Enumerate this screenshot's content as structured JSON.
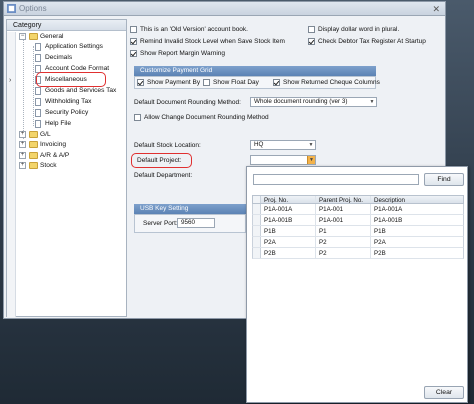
{
  "window": {
    "title": "Options"
  },
  "tree": {
    "header": "Category",
    "items": [
      {
        "label": "General"
      },
      {
        "label": "Application Settings"
      },
      {
        "label": "Decimals"
      },
      {
        "label": "Account Code Format"
      },
      {
        "label": "Miscellaneous"
      },
      {
        "label": "Goods and Services Tax"
      },
      {
        "label": "Withholding Tax"
      },
      {
        "label": "Security Policy"
      },
      {
        "label": "Help File"
      },
      {
        "label": "G/L"
      },
      {
        "label": "Invoicing"
      },
      {
        "label": "A/R & A/P"
      },
      {
        "label": "Stock"
      }
    ]
  },
  "options": {
    "old_version": "This is an 'Old Version' account book.",
    "dollar_word": "Display dollar word in plural.",
    "remind_stock": "Remind Invalid Stock Level when Save Stock Item",
    "check_debtor": "Check Debtor Tax Register At Startup",
    "margin_warning": "Show Report Margin Warning"
  },
  "payment_grid": {
    "title": "Customize Payment Grid",
    "show_payment_by": "Show Payment By",
    "show_float_day": "Show Float Day",
    "show_returned": "Show Returned Cheque Columns"
  },
  "rounding": {
    "label": "Default Document Rounding Method:",
    "value": "Whole document rounding (ver 3)",
    "allow_change": "Allow Change Document Rounding Method"
  },
  "stock": {
    "location_label": "Default Stock Location:",
    "location_value": "HQ",
    "project_label": "Default Project:",
    "department_label": "Default Department:"
  },
  "usb": {
    "title": "USB Key Setting",
    "port_label": "Server Port:",
    "port_value": "9560"
  },
  "popup": {
    "find_label": "Find",
    "clear_label": "Clear",
    "columns": [
      "Proj. No.",
      "Parent Proj. No.",
      "Description"
    ],
    "rows": [
      [
        "P1A-001A",
        "P1A-001",
        "P1A-001A"
      ],
      [
        "P1A-001B",
        "P1A-001",
        "P1A-001B"
      ],
      [
        "P1B",
        "P1",
        "P1B"
      ],
      [
        "P2A",
        "P2",
        "P2A"
      ],
      [
        "P2B",
        "P2",
        "P2B"
      ]
    ]
  },
  "colors": {
    "highlight": "#e03030",
    "group_header": "#5b82b4",
    "dropdown_accent": "#f3b24a"
  },
  "icons": [
    "app-icon",
    "close-icon",
    "folder-icon",
    "document-icon",
    "chevron-down-icon",
    "selector-arrow-icon"
  ]
}
